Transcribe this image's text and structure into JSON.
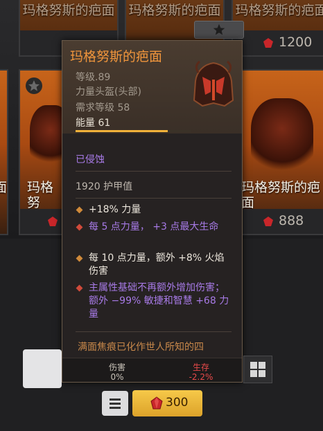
{
  "shop": {
    "top_cards": [
      {
        "name": "玛格努斯的疤面"
      },
      {
        "name": "玛格努斯的疤面"
      },
      {
        "name": "玛格努斯的疤面",
        "price": "1200"
      }
    ],
    "mid_cards": [
      {
        "name": "玛格努"
      },
      {
        "name": "玛格努斯的疤面",
        "price": "888"
      }
    ],
    "left_partial_name": "面"
  },
  "tooltip": {
    "title": "玛格努斯的疤面",
    "level": "等级.89",
    "type": "力量头盔(头部)",
    "required_level": "需求等级 58",
    "power": "能量 61",
    "power_fraction": 0.8,
    "status": "已侵蚀",
    "armor": "1920 护甲值",
    "affixes": [
      {
        "text": "+18% 力量",
        "bullet_color": "#d08a3a",
        "text_color": "#ece6dc"
      },
      {
        "text": "每 5 点力量， +3 点最大生命",
        "bullet_color": "#d04a3a",
        "text_color": "#a77ae6"
      },
      {
        "text": "每 10 点力量，额外 +8% 火焰伤害",
        "bullet_color": "#d08a3a",
        "text_color": "#ece6dc"
      },
      {
        "text": "主属性基础不再额外增加伤害；额外 −99% 敏捷和智慧 +68 力量",
        "bullet_color": "#d04a3a",
        "text_color": "#a77ae6"
      }
    ],
    "flavor": "满面焦痕已化作世人所知的四",
    "compare": {
      "damage_label": "伤害",
      "damage_value": "0%",
      "survival_label": "生存",
      "survival_value": "-2.2%"
    }
  },
  "buy": {
    "price": "300"
  },
  "colors": {
    "title": "#f0953c",
    "corrupted": "#a77ae6",
    "gold_button": "#f2c040",
    "negative": "#e84a4a"
  }
}
